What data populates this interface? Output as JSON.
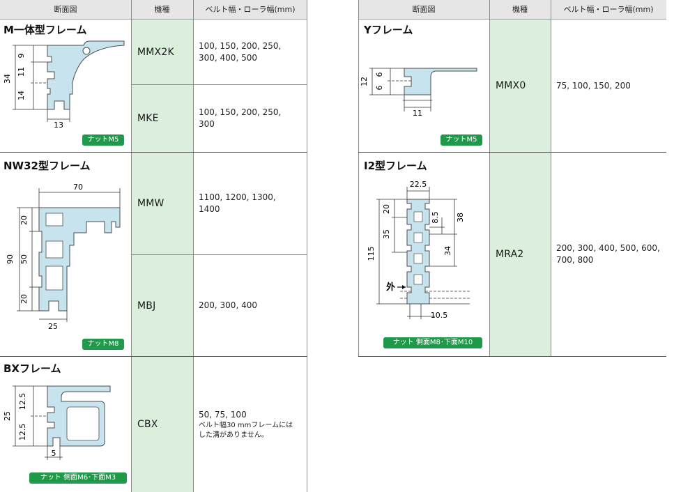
{
  "headers": {
    "section": "断面図",
    "model": "機種",
    "widths": "ベルト幅・ローラ幅(mm)"
  },
  "left": {
    "m_frame": {
      "title": "M一体型フレーム",
      "nut": "ナットM5",
      "dims": {
        "h_total": "34",
        "h_a": "9",
        "h_b": "11",
        "h_c": "14",
        "w": "13"
      },
      "rows": [
        {
          "model": "MMX2K",
          "widths": "100, 150, 200, 250, 300, 400, 500"
        },
        {
          "model": "MKE",
          "widths": "100, 150, 200, 250, 300"
        }
      ]
    },
    "nw32_frame": {
      "title": "NW32型フレーム",
      "nut": "ナットM8",
      "dims": {
        "w_top": "70",
        "h_total": "90",
        "h_a": "20",
        "h_b": "50",
        "h_c": "20",
        "w_bottom": "25"
      },
      "rows": [
        {
          "model": "MMW",
          "widths": "1100, 1200, 1300, 1400"
        },
        {
          "model": "MBJ",
          "widths": "200, 300, 400"
        }
      ]
    },
    "bx_frame": {
      "title": "BXフレーム",
      "nut": "ナット 側面M6･下面M3",
      "dims": {
        "h_total": "25",
        "h_a": "12.5",
        "h_b": "12.5",
        "w": "5"
      },
      "rows": [
        {
          "model": "CBX",
          "widths": "50, 75, 100",
          "note1": "ベルト幅30 mmフレームには",
          "note2": "した溝がありません。"
        }
      ]
    }
  },
  "right": {
    "y_frame": {
      "title": "Yフレーム",
      "nut": "ナットM5",
      "dims": {
        "h_total": "12",
        "h_a": "6",
        "h_b": "6",
        "w": "11"
      },
      "rows": [
        {
          "model": "MMX0",
          "widths": "75, 100, 150, 200"
        }
      ]
    },
    "i2_frame": {
      "title": "I2型フレーム",
      "nut": "ナット 側面M8･下面M10",
      "outside": "外",
      "dims": {
        "w_top": "22.5",
        "h_total": "115",
        "h_a": "20",
        "h_b": "35",
        "h_c": "8.5",
        "h_d": "38",
        "h_e": "34",
        "w_bottom": "10.5"
      },
      "rows": [
        {
          "model": "MRA2",
          "widths": "200, 300, 400, 500, 600, 700, 800"
        }
      ]
    }
  },
  "colors": {
    "header_bg": "#e6e6e6",
    "model_bg": "#dcefdc",
    "badge_bg": "#1f9a4a",
    "profile_fill": "#c7e4ee",
    "profile_stroke": "#4d4d4d"
  }
}
